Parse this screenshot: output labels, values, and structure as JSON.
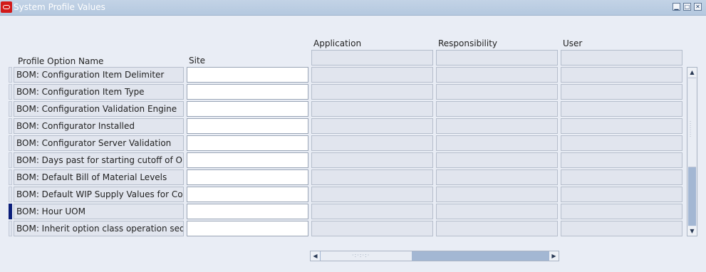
{
  "window": {
    "title": "System Profile Values",
    "minimize_glyph": "▁",
    "maximize_glyph": "□",
    "close_glyph": "✕"
  },
  "columns": {
    "profile_option_name": "Profile Option Name",
    "site": "Site",
    "application": "Application",
    "responsibility": "Responsibility",
    "user": "User"
  },
  "rows": [
    {
      "name": "BOM: Configuration Item Delimiter",
      "site": "",
      "active": false
    },
    {
      "name": "BOM: Configuration Item Type",
      "site": "",
      "active": false
    },
    {
      "name": "BOM: Configuration Validation Engine",
      "site": "",
      "active": false
    },
    {
      "name": "BOM: Configurator Installed",
      "site": "",
      "active": false
    },
    {
      "name": "BOM: Configurator Server Validation",
      "site": "",
      "active": false
    },
    {
      "name": "BOM: Days past for starting cutoff of Orc",
      "site": "",
      "active": false
    },
    {
      "name": "BOM: Default Bill of Material Levels",
      "site": "",
      "active": false
    },
    {
      "name": "BOM: Default WIP Supply Values for Co",
      "site": "",
      "active": false
    },
    {
      "name": "BOM: Hour UOM",
      "site": "",
      "active": true
    },
    {
      "name": "BOM: Inherit option class operation sequ",
      "site": "",
      "active": false
    }
  ],
  "scrollbars": {
    "up_glyph": "▲",
    "down_glyph": "▼",
    "left_glyph": "◀",
    "right_glyph": "▶"
  },
  "colors": {
    "title_bar": "#b4c8df",
    "active_record_indicator": "#0b1e7a",
    "logo": "#d21a1a"
  }
}
